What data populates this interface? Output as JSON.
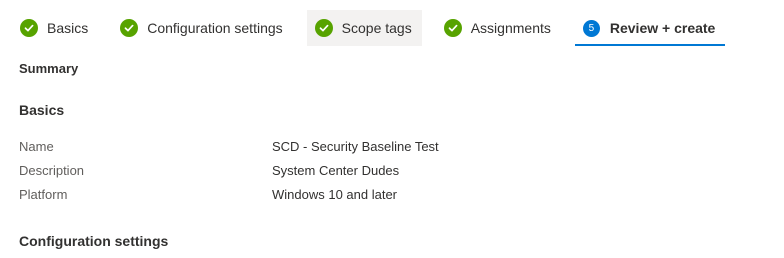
{
  "wizard": {
    "steps": [
      {
        "label": "Basics",
        "state": "complete"
      },
      {
        "label": "Configuration settings",
        "state": "complete"
      },
      {
        "label": "Scope tags",
        "state": "complete"
      },
      {
        "label": "Assignments",
        "state": "complete"
      },
      {
        "label": "Review + create",
        "state": "current",
        "number": "5"
      }
    ]
  },
  "summary": {
    "title": "Summary",
    "basics": {
      "heading": "Basics",
      "fields": [
        {
          "label": "Name",
          "value": "SCD - Security Baseline Test"
        },
        {
          "label": "Description",
          "value": "System Center Dudes"
        },
        {
          "label": "Platform",
          "value": "Windows 10 and later"
        }
      ]
    },
    "configuration_heading": "Configuration settings"
  },
  "colors": {
    "complete": "#57a300",
    "accent": "#0078d4",
    "hover_bg": "#f3f2f1"
  },
  "icons": {
    "complete": "checkmark-circle-icon",
    "current": "step-number-icon"
  }
}
